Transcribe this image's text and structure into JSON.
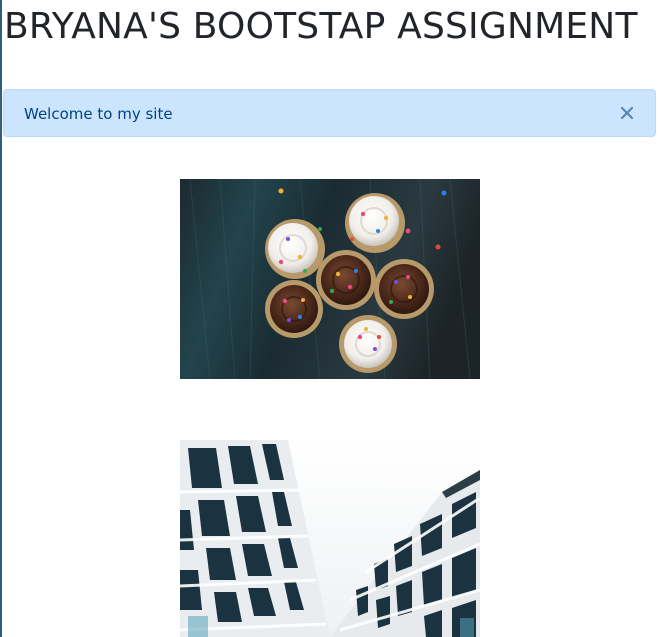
{
  "page": {
    "title": "BRYANA'S BOOTSTAP ASSIGNMENT"
  },
  "alert": {
    "message": "Welcome to my site",
    "close_icon": "close-icon"
  },
  "images": [
    {
      "name": "cupcakes-image",
      "subject": "chocolate and vanilla cupcakes with sprinkles on a dark wooden table"
    },
    {
      "name": "building-image",
      "subject": "upward view between white modern apartment buildings"
    }
  ],
  "colors": {
    "alert_background": "#cce5ff",
    "alert_text": "#004085",
    "title_text": "#212529"
  }
}
